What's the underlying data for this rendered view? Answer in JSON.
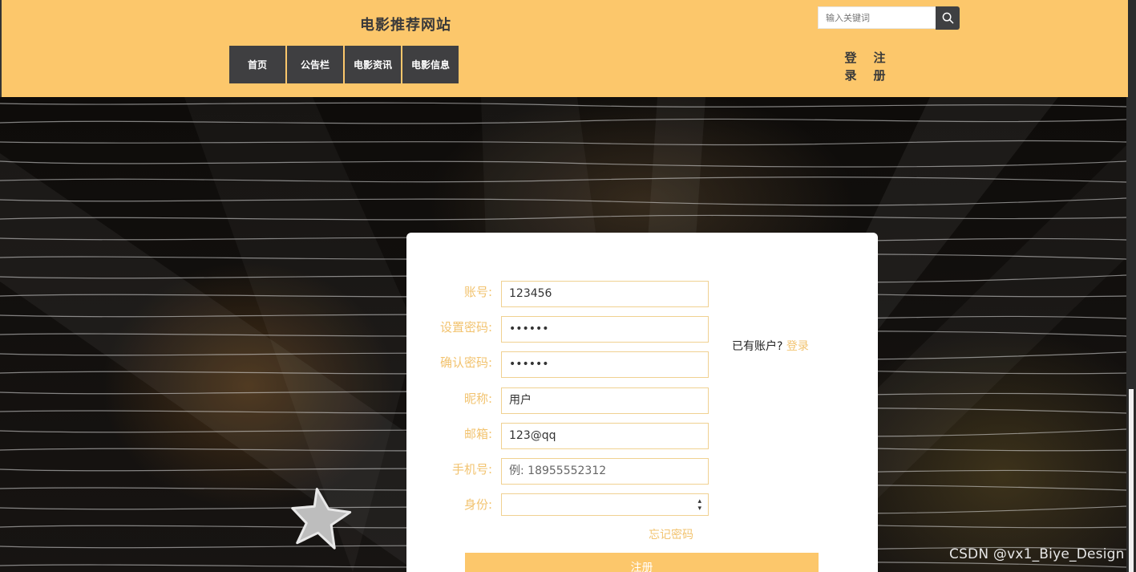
{
  "header": {
    "title": "电影推荐网站",
    "search_placeholder": "输入关键词",
    "search_icon": "search-icon",
    "nav": [
      {
        "label": "首页"
      },
      {
        "label": "公告栏"
      },
      {
        "label": "电影资讯"
      },
      {
        "label": "电影信息"
      }
    ],
    "login_label": "登录",
    "register_label": "注册"
  },
  "form": {
    "fields": [
      {
        "label": "账号:",
        "value": "123456"
      },
      {
        "label": "设置密码:",
        "value": "••••••"
      },
      {
        "label": "确认密码:",
        "value": "••••••"
      },
      {
        "label": "昵称:",
        "value": "用户"
      },
      {
        "label": "邮箱:",
        "value": "123@qq"
      },
      {
        "label": "手机号:",
        "placeholder": "例: 18955552312"
      },
      {
        "label": "身份:",
        "value": ""
      }
    ],
    "have_account_text": "已有账户?",
    "login_link": "登录",
    "forgot_password": "忘记密码",
    "submit_label": "注册"
  },
  "watermark": "CSDN @vx1_Biye_Design",
  "colors": {
    "header_bg": "#fcc76b",
    "nav_bg": "#3f3f41",
    "accent": "#f2c36f",
    "field_border": "#f0d191"
  }
}
